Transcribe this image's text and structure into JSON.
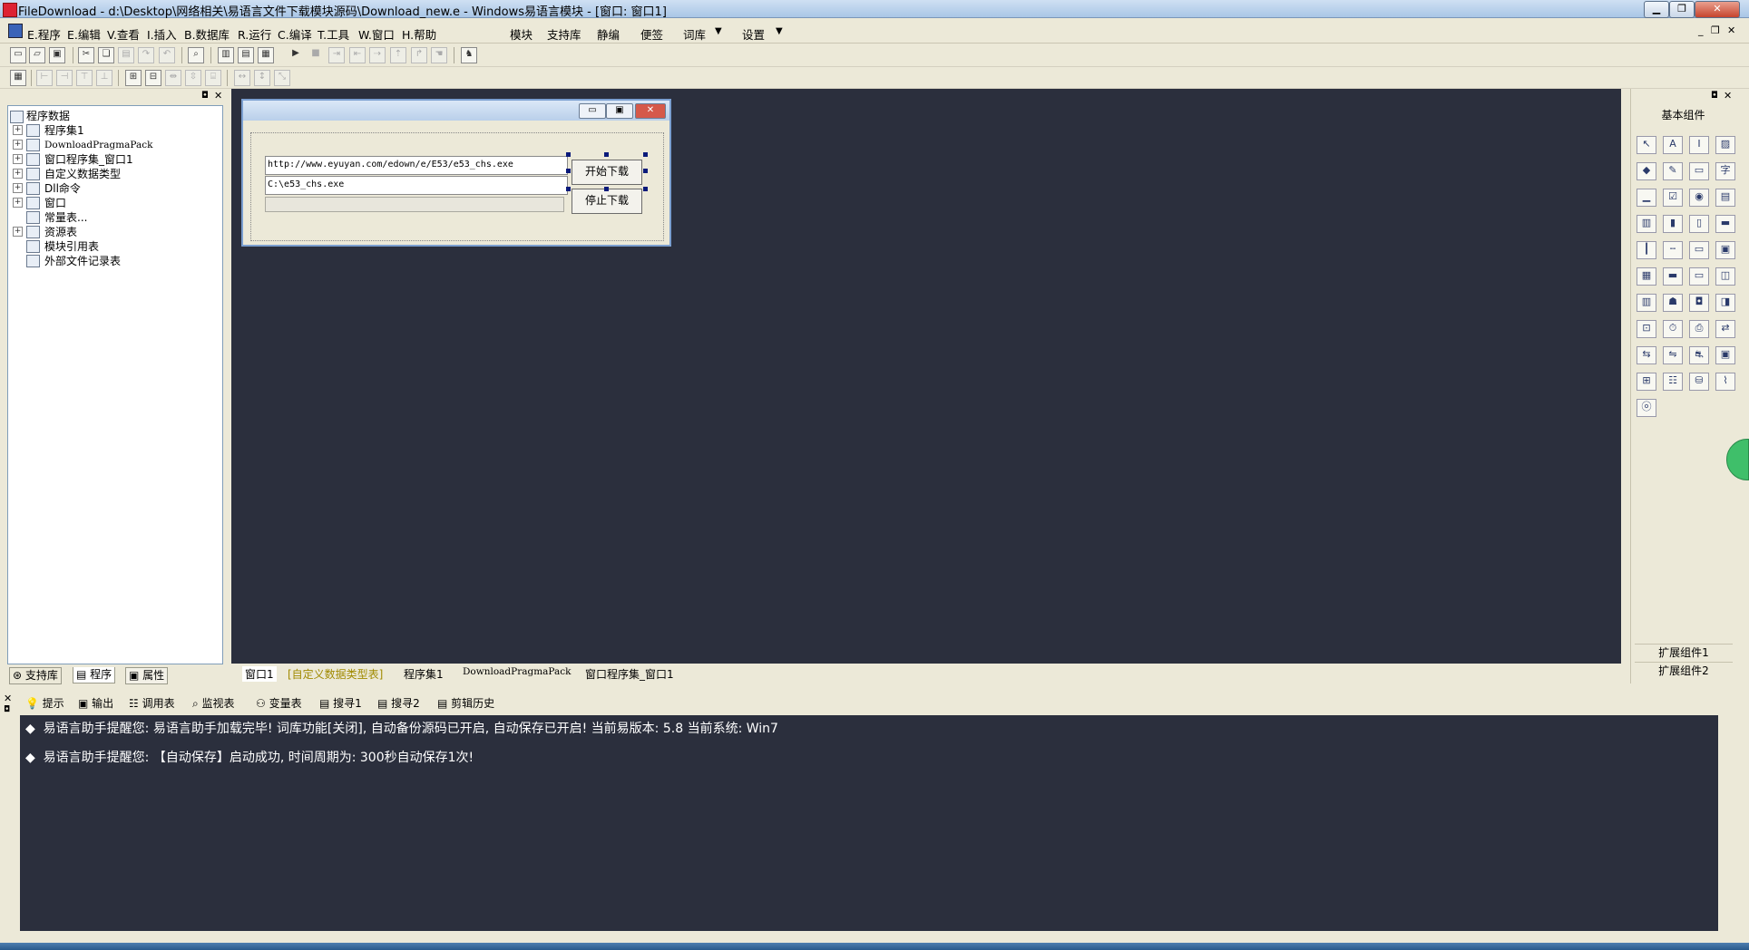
{
  "window": {
    "title": "FileDownload - d:\\Desktop\\网络相关\\易语言文件下载模块源码\\Download_new.e - Windows易语言模块 - [窗口: 窗口1]"
  },
  "menu": {
    "items": [
      "E.程序",
      "E.编辑",
      "V.查看",
      "I.插入",
      "B.数据库",
      "R.运行",
      "C.编译",
      "T.工具",
      "W.窗口",
      "H.帮助"
    ],
    "extra": [
      "模块",
      "支持库",
      "静编",
      "便签",
      "词库",
      "设置"
    ]
  },
  "tree": {
    "root": "程序数据",
    "items": [
      "程序集1",
      "DownloadPragmaPack",
      "窗口程序集_窗口1",
      "自定义数据类型",
      "Dll命令",
      "窗口",
      "常量表...",
      "资源表",
      "模块引用表",
      "外部文件记录表"
    ]
  },
  "left_tabs": [
    "支持库",
    "程序",
    "属性"
  ],
  "form": {
    "url_value": "http://www.eyuyan.com/edown/e/E53/e53_chs.exe",
    "path_value": "C:\\e53_chs.exe",
    "start_button": "开始下载",
    "stop_button": "停止下载"
  },
  "doc_tabs": [
    "窗口1",
    "[自定义数据类型表]",
    "程序集1",
    "DownloadPragmaPack",
    "窗口程序集_窗口1"
  ],
  "components": {
    "title": "基本组件",
    "ext1": "扩展组件1",
    "ext2": "扩展组件2",
    "icons": [
      "pointer-icon",
      "label-icon",
      "picture-icon",
      "shape-icon",
      "edit-icon",
      "box-icon",
      "text-icon",
      "line-icon",
      "check-icon",
      "radio-icon",
      "group-icon",
      "list-icon",
      "list2-icon",
      "scroll-icon",
      "vscroll-icon",
      "ruler-icon",
      "hline-icon",
      "frame-icon",
      "progress-icon",
      "window-icon",
      "grid-icon",
      "combo-icon",
      "folder-icon",
      "doc-icon",
      "tree-icon",
      "db-icon",
      "split-icon",
      "table-icon",
      "timer-icon",
      "printer-icon",
      "net1-icon",
      "net2-icon",
      "net3-icon",
      "fish-icon",
      "form-icon",
      "form2-icon",
      "tree2-icon",
      "db2-icon",
      "chart-icon",
      "odbc-icon",
      "odbc2-icon"
    ]
  },
  "output_tabs": [
    "提示",
    "输出",
    "调用表",
    "监视表",
    "变量表",
    "搜寻1",
    "搜寻2",
    "剪辑历史"
  ],
  "output": {
    "lines": [
      "易语言助手提醒您:  易语言助手加载完毕!  词库功能[关闭], 自动备份源码已开启, 自动保存已开启!  当前易版本: 5.8  当前系统: Win7",
      "易语言助手提醒您: 【自动保存】启动成功, 时间周期为: 300秒自动保存1次!"
    ]
  }
}
